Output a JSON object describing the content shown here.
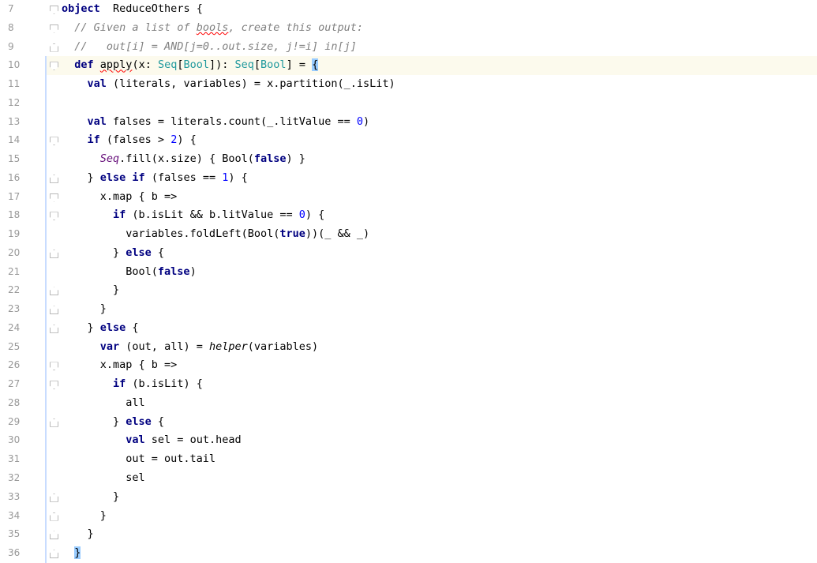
{
  "editor": {
    "caret_line": 10,
    "colors": {
      "keyword": "#000080",
      "comment": "#808080",
      "number": "#0000ff",
      "type": "#20999d",
      "object": "#660e7a",
      "current_line": "#fcfaed"
    }
  },
  "lines": [
    {
      "no": "7",
      "fold": "open",
      "tokens": [
        [
          "kw",
          "object"
        ],
        [
          "",
          "  ReduceOthers {"
        ]
      ]
    },
    {
      "no": "8",
      "fold": "open",
      "tokens": [
        [
          "",
          "  "
        ],
        [
          "cm",
          "// Given a list of "
        ],
        [
          "cm squiggle",
          "bools"
        ],
        [
          "cm",
          ", create this output:"
        ]
      ]
    },
    {
      "no": "9",
      "fold": "close",
      "tokens": [
        [
          "",
          "  "
        ],
        [
          "cm",
          "//   out[i] = AND[j=0..out.size, j!=i] in[j]"
        ]
      ]
    },
    {
      "no": "10",
      "fold": "open",
      "tokens": [
        [
          "",
          "  "
        ],
        [
          "kw",
          "def"
        ],
        [
          "",
          " "
        ],
        [
          "squiggle",
          "apply"
        ],
        [
          "",
          "(x: "
        ],
        [
          "type",
          "Seq"
        ],
        [
          "",
          "["
        ],
        [
          "type",
          "Bool"
        ],
        [
          "",
          "]): "
        ],
        [
          "type",
          "Seq"
        ],
        [
          "",
          "["
        ],
        [
          "type",
          "Bool"
        ],
        [
          "",
          "] = "
        ],
        [
          "brace-match",
          "{"
        ]
      ]
    },
    {
      "no": "11",
      "fold": "",
      "tokens": [
        [
          "",
          "    "
        ],
        [
          "kw",
          "val"
        ],
        [
          "",
          " (literals, variables) = x.partition(_.isLit)"
        ]
      ]
    },
    {
      "no": "12",
      "fold": "",
      "tokens": [
        [
          "",
          ""
        ]
      ]
    },
    {
      "no": "13",
      "fold": "",
      "tokens": [
        [
          "",
          "    "
        ],
        [
          "kw",
          "val"
        ],
        [
          "",
          " falses = literals.count(_.litValue == "
        ],
        [
          "num",
          "0"
        ],
        [
          "",
          ")"
        ]
      ]
    },
    {
      "no": "14",
      "fold": "open",
      "tokens": [
        [
          "",
          "    "
        ],
        [
          "kw",
          "if"
        ],
        [
          "",
          " (falses > "
        ],
        [
          "num",
          "2"
        ],
        [
          "",
          ") {"
        ]
      ]
    },
    {
      "no": "15",
      "fold": "",
      "tokens": [
        [
          "",
          "      "
        ],
        [
          "obj",
          "Seq"
        ],
        [
          "",
          ".fill(x.size) { Bool("
        ],
        [
          "kw",
          "false"
        ],
        [
          "",
          ") }"
        ]
      ]
    },
    {
      "no": "16",
      "fold": "close",
      "tokens": [
        [
          "",
          "    } "
        ],
        [
          "kw",
          "else if"
        ],
        [
          "",
          " (falses == "
        ],
        [
          "num",
          "1"
        ],
        [
          "",
          ") {"
        ]
      ]
    },
    {
      "no": "17",
      "fold": "open",
      "tokens": [
        [
          "",
          "      x.map { b =>"
        ]
      ]
    },
    {
      "no": "18",
      "fold": "open",
      "tokens": [
        [
          "",
          "        "
        ],
        [
          "kw",
          "if"
        ],
        [
          "",
          " (b.isLit && b.litValue == "
        ],
        [
          "num",
          "0"
        ],
        [
          "",
          ") {"
        ]
      ]
    },
    {
      "no": "19",
      "fold": "",
      "tokens": [
        [
          "",
          "          variables.foldLeft(Bool("
        ],
        [
          "kw",
          "true"
        ],
        [
          "",
          "))(_ && _)"
        ]
      ]
    },
    {
      "no": "20",
      "fold": "close",
      "tokens": [
        [
          "",
          "        } "
        ],
        [
          "kw",
          "else"
        ],
        [
          "",
          " {"
        ]
      ]
    },
    {
      "no": "21",
      "fold": "",
      "tokens": [
        [
          "",
          "          Bool("
        ],
        [
          "kw",
          "false"
        ],
        [
          "",
          ")"
        ]
      ]
    },
    {
      "no": "22",
      "fold": "close",
      "tokens": [
        [
          "",
          "        }"
        ]
      ]
    },
    {
      "no": "23",
      "fold": "close",
      "tokens": [
        [
          "",
          "      }"
        ]
      ]
    },
    {
      "no": "24",
      "fold": "close",
      "tokens": [
        [
          "",
          "    } "
        ],
        [
          "kw",
          "else"
        ],
        [
          "",
          " {"
        ]
      ]
    },
    {
      "no": "25",
      "fold": "",
      "tokens": [
        [
          "",
          "      "
        ],
        [
          "kw",
          "var"
        ],
        [
          "",
          " (out, all) = "
        ],
        [
          "fn-it",
          "helper"
        ],
        [
          "",
          "(variables)"
        ]
      ]
    },
    {
      "no": "26",
      "fold": "open",
      "tokens": [
        [
          "",
          "      x.map { b =>"
        ]
      ]
    },
    {
      "no": "27",
      "fold": "open",
      "tokens": [
        [
          "",
          "        "
        ],
        [
          "kw",
          "if"
        ],
        [
          "",
          " (b.isLit) {"
        ]
      ]
    },
    {
      "no": "28",
      "fold": "",
      "tokens": [
        [
          "",
          "          all"
        ]
      ]
    },
    {
      "no": "29",
      "fold": "close",
      "tokens": [
        [
          "",
          "        } "
        ],
        [
          "kw",
          "else"
        ],
        [
          "",
          " {"
        ]
      ]
    },
    {
      "no": "30",
      "fold": "",
      "tokens": [
        [
          "",
          "          "
        ],
        [
          "kw",
          "val"
        ],
        [
          "",
          " sel = out.head"
        ]
      ]
    },
    {
      "no": "31",
      "fold": "",
      "tokens": [
        [
          "",
          "          out = out.tail"
        ]
      ]
    },
    {
      "no": "32",
      "fold": "",
      "tokens": [
        [
          "",
          "          sel"
        ]
      ]
    },
    {
      "no": "33",
      "fold": "close",
      "tokens": [
        [
          "",
          "        }"
        ]
      ]
    },
    {
      "no": "34",
      "fold": "close",
      "tokens": [
        [
          "",
          "      }"
        ]
      ]
    },
    {
      "no": "35",
      "fold": "close",
      "tokens": [
        [
          "",
          "    }"
        ]
      ]
    },
    {
      "no": "36",
      "fold": "close",
      "tokens": [
        [
          "",
          "  "
        ],
        [
          "brace-match",
          "}"
        ]
      ]
    }
  ]
}
